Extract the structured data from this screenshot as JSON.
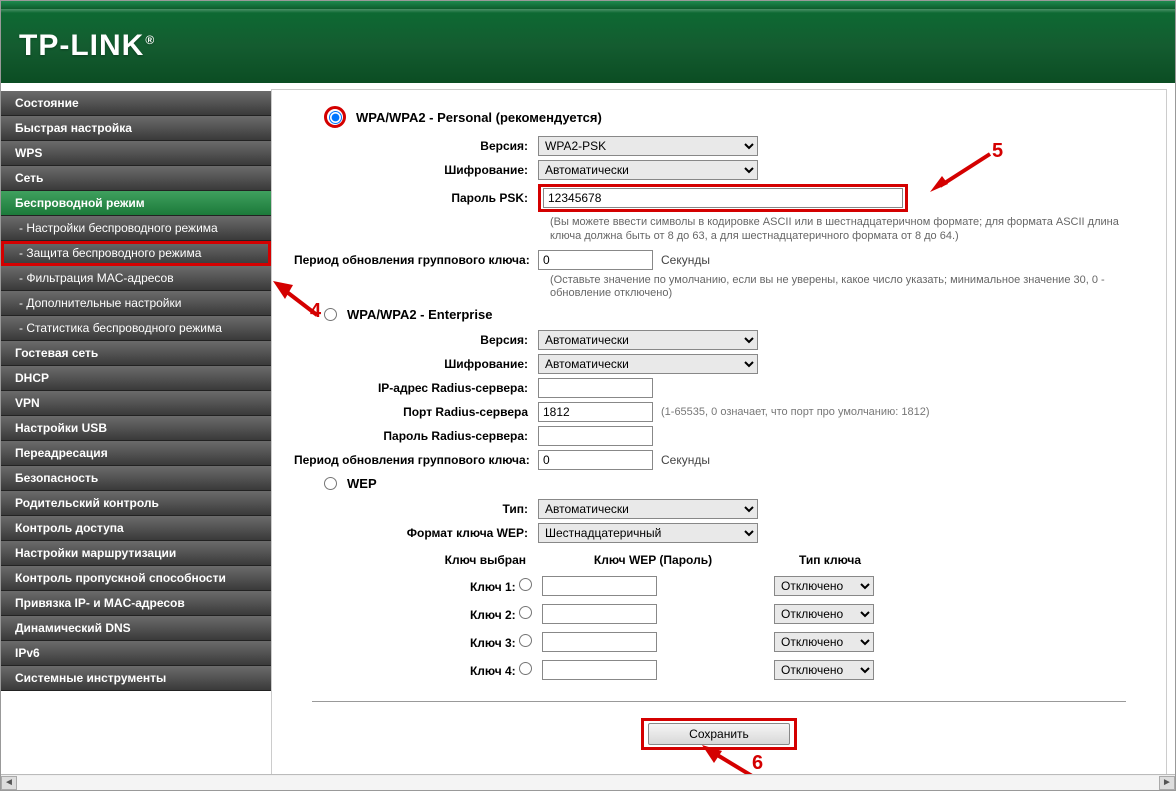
{
  "brand": "TP-LINK",
  "sidebar": {
    "items": [
      {
        "label": "Состояние"
      },
      {
        "label": "Быстрая настройка"
      },
      {
        "label": "WPS"
      },
      {
        "label": "Сеть"
      },
      {
        "label": "Беспроводной режим",
        "active": true
      },
      {
        "label": "- Настройки беспроводного режима",
        "sub": true
      },
      {
        "label": "- Защита беспроводного режима",
        "sub": true,
        "highlighted": true
      },
      {
        "label": "- Фильтрация MAC-адресов",
        "sub": true
      },
      {
        "label": "- Дополнительные настройки",
        "sub": true
      },
      {
        "label": "- Статистика беспроводного режима",
        "sub": true
      },
      {
        "label": "Гостевая сеть"
      },
      {
        "label": "DHCP"
      },
      {
        "label": "VPN"
      },
      {
        "label": "Настройки USB"
      },
      {
        "label": "Переадресация"
      },
      {
        "label": "Безопасность"
      },
      {
        "label": "Родительский контроль"
      },
      {
        "label": "Контроль доступа"
      },
      {
        "label": "Настройки маршрутизации"
      },
      {
        "label": "Контроль пропускной способности"
      },
      {
        "label": "Привязка IP- и MAC-адресов"
      },
      {
        "label": "Динамический DNS"
      },
      {
        "label": "IPv6"
      },
      {
        "label": "Системные инструменты"
      }
    ]
  },
  "main": {
    "personal": {
      "title": "WPA/WPA2 - Personal (рекомендуется)",
      "version_label": "Версия:",
      "version_value": "WPA2-PSK",
      "encryption_label": "Шифрование:",
      "encryption_value": "Автоматически",
      "psk_label": "Пароль PSK:",
      "psk_value": "12345678",
      "psk_help": "(Вы можете ввести символы в кодировке ASCII или в шестнадцатеричном формате; для формата ASCII длина ключа должна быть от 8 до 63, а для шестнадцатеричного формата от 8 до 64.)",
      "group_key_label": "Период обновления группового ключа:",
      "group_key_value": "0",
      "group_key_unit": "Секунды",
      "group_key_help": "(Оставьте значение по умолчанию, если вы не уверены, какое число указать; минимальное значение 30, 0 - обновление отключено)"
    },
    "enterprise": {
      "title": "WPA/WPA2 - Enterprise",
      "version_label": "Версия:",
      "version_value": "Автоматически",
      "encryption_label": "Шифрование:",
      "encryption_value": "Автоматически",
      "radius_ip_label": "IP-адрес Radius-сервера:",
      "radius_ip_value": "",
      "radius_port_label": "Порт Radius-сервера",
      "radius_port_value": "1812",
      "radius_port_help": "(1-65535, 0 означает, что порт про умолчанию: 1812)",
      "radius_pwd_label": "Пароль Radius-сервера:",
      "radius_pwd_value": "",
      "group_key_label": "Период обновления группового ключа:",
      "group_key_value": "0",
      "group_key_unit": "Секунды"
    },
    "wep": {
      "title": "WEP",
      "type_label": "Тип:",
      "type_value": "Автоматически",
      "format_label": "Формат ключа WEP:",
      "format_value": "Шестнадцатеричный",
      "col_selected": "Ключ выбран",
      "col_key": "Ключ WEP (Пароль)",
      "col_type": "Тип ключа",
      "rows": [
        {
          "label": "Ключ 1:",
          "value": "",
          "type": "Отключено"
        },
        {
          "label": "Ключ 2:",
          "value": "",
          "type": "Отключено"
        },
        {
          "label": "Ключ 3:",
          "value": "",
          "type": "Отключено"
        },
        {
          "label": "Ключ 4:",
          "value": "",
          "type": "Отключено"
        }
      ]
    },
    "save": "Сохранить"
  },
  "annotations": {
    "a4": "4",
    "a5": "5",
    "a6": "6"
  }
}
